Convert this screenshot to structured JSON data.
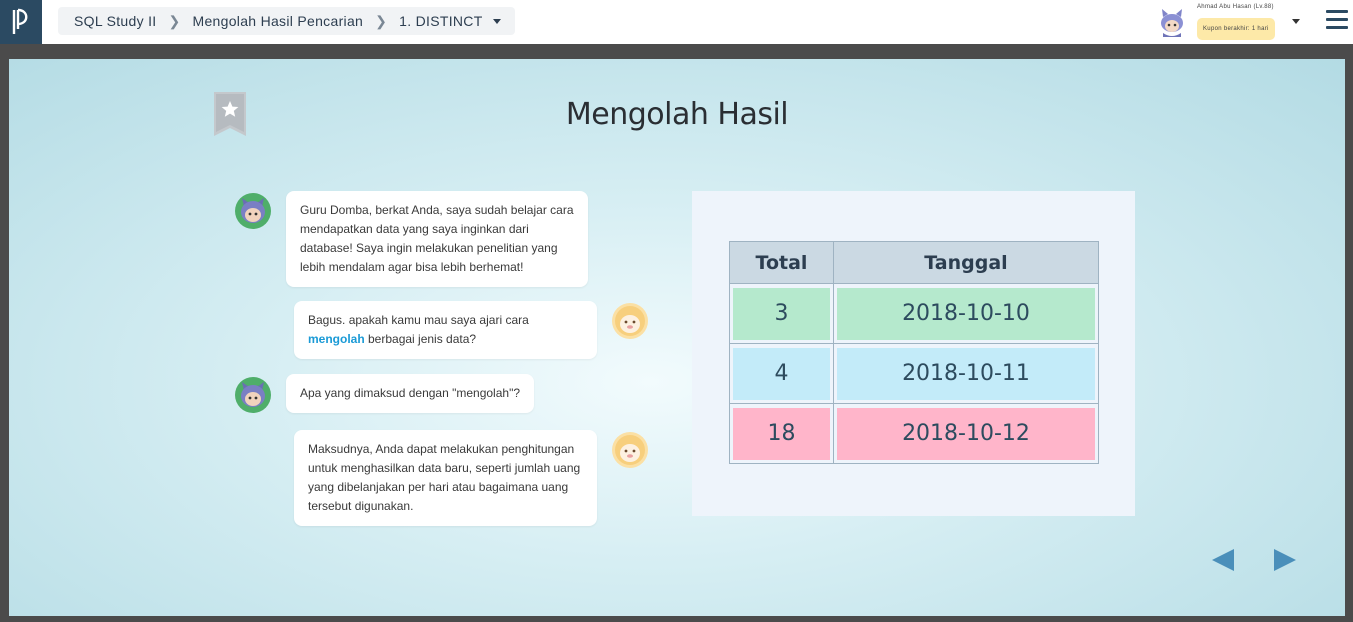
{
  "topbar": {
    "breadcrumb": {
      "course": "SQL Study II",
      "chapter": "Mengolah Hasil Pencarian",
      "lesson": "1. DISTINCT"
    },
    "user": {
      "name": "Ahmad Abu Hasan (Lv.88)",
      "coupon": "Kupon berakhir: 1 hari"
    }
  },
  "slide": {
    "title": "Mengolah Hasil",
    "chat": [
      {
        "speaker": "student",
        "text": "Guru Domba, berkat Anda, saya sudah belajar cara mendapatkan data yang saya inginkan dari database! Saya ingin melakukan penelitian yang lebih mendalam agar bisa lebih berhemat!"
      },
      {
        "speaker": "teacher",
        "text_before": "Bagus. apakah kamu mau saya ajari cara ",
        "highlight": "mengolah",
        "text_after": " berbagai jenis data?"
      },
      {
        "speaker": "student",
        "text": "Apa yang dimaksud dengan  \"mengolah\"?"
      },
      {
        "speaker": "teacher",
        "text": "Maksudnya, Anda dapat melakukan penghitungan untuk menghasilkan data baru, seperti jumlah uang yang dibelanjakan per hari atau bagaimana uang tersebut digunakan."
      }
    ],
    "table": {
      "headers": [
        "Total",
        "Tanggal"
      ],
      "rows": [
        {
          "total": "3",
          "date": "2018-10-10",
          "color": "#b5e9cd"
        },
        {
          "total": "4",
          "date": "2018-10-11",
          "color": "#c3ebf9"
        },
        {
          "total": "18",
          "date": "2018-10-12",
          "color": "#ffb5ca"
        }
      ]
    }
  },
  "colors": {
    "accent": "#1a9ad6",
    "nav_arrow": "#4a8fba",
    "logo_bg": "#2b4a62"
  },
  "icons": {
    "logo": "brand-logo-icon",
    "bookmark": "bookmark-star-icon",
    "menu": "hamburger-menu-icon",
    "prev": "prev-arrow-icon",
    "next": "next-arrow-icon"
  }
}
